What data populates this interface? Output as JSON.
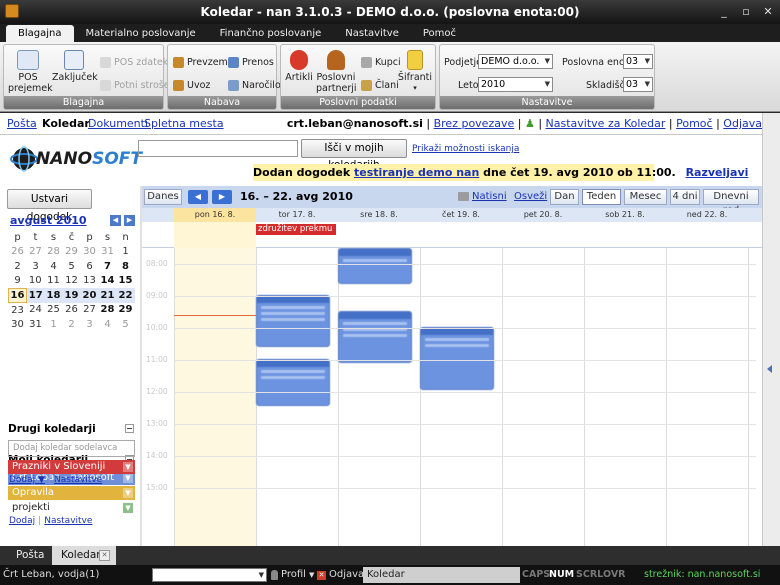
{
  "window": {
    "title": "Koledar - nan 3.1.0.3 - DEMO d.o.o. (poslovna enota:00)"
  },
  "ribbon": {
    "tabs": [
      "Blagajna",
      "Materialno poslovanje",
      "Finančno poslovanje",
      "Nastavitve",
      "Pomoč"
    ],
    "active_tab": "Blagajna",
    "groups": {
      "blagajna": {
        "caption": "Blagajna",
        "pos_prejemek": "POS prejemek",
        "zakljucek": "Zaključek",
        "pos_zdatek": "POS zdatek",
        "potni_strosek": "Potni strošek"
      },
      "nabava": {
        "caption": "Nabava",
        "prevzem": "Prevzem",
        "prenos": "Prenos",
        "uvoz": "Uvoz",
        "narocilo": "Naročilo"
      },
      "poslovni": {
        "caption": "Poslovni podatki",
        "artikli": "Artikli",
        "poslovni_partnerji": "Poslovni partnerji",
        "kupci": "Kupci",
        "clani": "Člani",
        "sifranti": "Šifranti"
      },
      "nastavitve": {
        "caption": "Nastavitve",
        "podjetje_label": "Podjetje",
        "podjetje_value": "DEMO d.o.o.",
        "leto_label": "Leto",
        "leto_value": "2010",
        "enota_label": "Poslovna enota",
        "enota_value": "03",
        "skladisce_label": "Skladišče",
        "skladisce_value": "03"
      }
    }
  },
  "toplinks": {
    "posta": "Pošta",
    "koledar": "Koledar",
    "dokumenti": "Dokumenti",
    "spletna_mesta": "Spletna mesta",
    "email": "crt.leban@nanosoft.si",
    "brez_povezave": "Brez povezave",
    "nastavitve": "Nastavitve za Koledar",
    "pomoc": "Pomoč",
    "odjava": "Odjava"
  },
  "logo": {
    "prefix": "NANO",
    "suffix": "SOFT"
  },
  "search": {
    "button": "Išči v mojih koledarjih",
    "options": "Prikaži možnosti iskanja"
  },
  "notice": {
    "text_before": "Dodan dogodek ",
    "event_link": "testiranje demo nan",
    "text_after": " dne čet 19. avg 2010 ob 11:00.",
    "undo": "Razveljavi"
  },
  "sidebar": {
    "create": "Ustvari dogodek",
    "month": "avgust 2010",
    "weekdays": [
      "p",
      "t",
      "s",
      "č",
      "p",
      "s",
      "n"
    ],
    "weeks": [
      [
        "26",
        "27",
        "28",
        "29",
        "30",
        "31",
        "1"
      ],
      [
        "2",
        "3",
        "4",
        "5",
        "6",
        "7",
        "8"
      ],
      [
        "9",
        "10",
        "11",
        "12",
        "13",
        "14",
        "15"
      ],
      [
        "16",
        "17",
        "18",
        "19",
        "20",
        "21",
        "22"
      ],
      [
        "23",
        "24",
        "25",
        "26",
        "27",
        "28",
        "29"
      ],
      [
        "30",
        "31",
        "1",
        "2",
        "3",
        "4",
        "5"
      ]
    ],
    "my_calendars": {
      "title": "Moji koledarji",
      "items": [
        {
          "label": "Črt Leban - nanosoft",
          "color": "#6e8fd8"
        },
        {
          "label": "Opravila",
          "color": "#e2b43d"
        },
        {
          "label": "projekti",
          "color": "#ffffff"
        }
      ],
      "add": "Dodaj",
      "settings": "Nastavitve"
    },
    "other_calendars": {
      "title": "Drugi koledarji",
      "add_placeholder": "Dodaj koledar sodelavca",
      "items": [
        {
          "label": "Prazniki v Sloveniji",
          "color": "#d13b3b"
        }
      ],
      "add": "Dodaj ▼",
      "settings": "Nastavitve"
    }
  },
  "calendar": {
    "today_btn": "Danes",
    "range": "16. – 22. avg 2010",
    "print": "Natisni",
    "refresh": "Osveži",
    "views": [
      "Dan",
      "Teden",
      "Mesec",
      "4 dni",
      "Dnevni red"
    ],
    "active_view": "Teden",
    "days": [
      "pon 16. 8.",
      "tor 17. 8.",
      "sre 18. 8.",
      "čet 19. 8.",
      "pet 20. 8.",
      "sob 21. 8.",
      "ned 22. 8."
    ],
    "today_index": 0,
    "allday_event": "združitev prekmu",
    "hours": [
      "08:00",
      "09:00",
      "10:00",
      "11:00",
      "12:00",
      "13:00",
      "14:00",
      "15:00"
    ]
  },
  "doc_tabs": [
    "Pošta",
    "Koledar"
  ],
  "status": {
    "user": "Črt Leban, vodja(1)",
    "profil": "Profil",
    "odjava": "Odjava",
    "module": "Koledar",
    "indicators": [
      "CAPS",
      "NUM",
      "SCRL",
      "OVR"
    ],
    "server": "strežnik: nan.nanosoft.si"
  },
  "colors": {
    "accent": "#3a6fd4",
    "event": "#6c93e0",
    "today": "#fbe3a0",
    "notice": "#fff1a8"
  }
}
